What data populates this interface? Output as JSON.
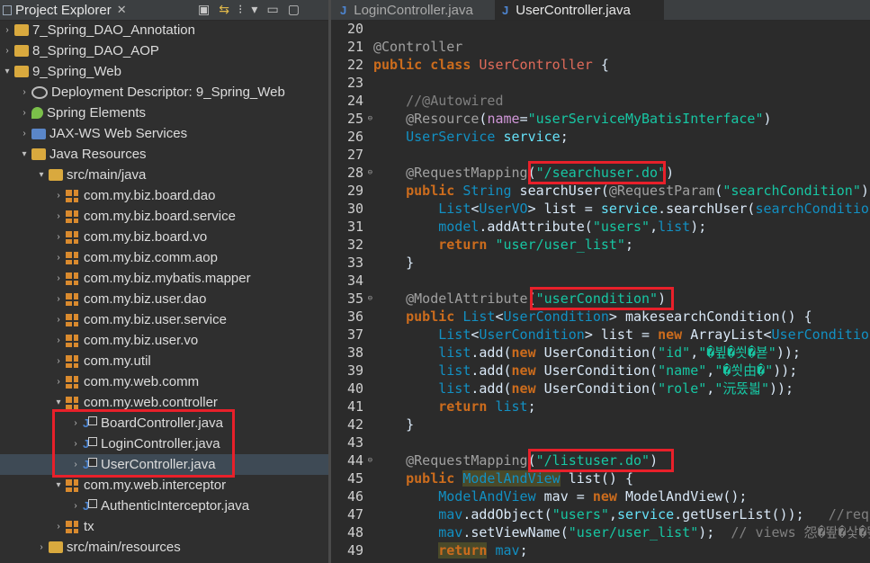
{
  "explorer": {
    "title": "Project Explorer",
    "close": "✕",
    "tools": [
      "▣",
      "⇆",
      "⁝",
      "▾",
      "▭",
      "▢"
    ],
    "rows": [
      {
        "label": "7_Spring_DAO_Annotation",
        "arrow": "›",
        "icon": "project",
        "depth": 0
      },
      {
        "label": "8_Spring_DAO_AOP",
        "arrow": "›",
        "icon": "project",
        "depth": 0
      },
      {
        "label": "9_Spring_Web",
        "arrow": "▾",
        "icon": "project",
        "depth": 0
      },
      {
        "label": "Deployment Descriptor: 9_Spring_Web",
        "arrow": "›",
        "icon": "gear",
        "depth": 1
      },
      {
        "label": "Spring Elements",
        "arrow": "›",
        "icon": "spring",
        "depth": 1
      },
      {
        "label": "JAX-WS Web Services",
        "arrow": "›",
        "icon": "web",
        "depth": 1
      },
      {
        "label": "Java Resources",
        "arrow": "▾",
        "icon": "folder",
        "depth": 1
      },
      {
        "label": "src/main/java",
        "arrow": "▾",
        "icon": "folder",
        "depth": 2
      },
      {
        "label": "com.my.biz.board.dao",
        "arrow": "›",
        "icon": "package",
        "depth": 3
      },
      {
        "label": "com.my.biz.board.service",
        "arrow": "›",
        "icon": "package",
        "depth": 3
      },
      {
        "label": "com.my.biz.board.vo",
        "arrow": "›",
        "icon": "package",
        "depth": 3
      },
      {
        "label": "com.my.biz.comm.aop",
        "arrow": "›",
        "icon": "package",
        "depth": 3
      },
      {
        "label": "com.my.biz.mybatis.mapper",
        "arrow": "›",
        "icon": "package",
        "depth": 3
      },
      {
        "label": "com.my.biz.user.dao",
        "arrow": "›",
        "icon": "package",
        "depth": 3
      },
      {
        "label": "com.my.biz.user.service",
        "arrow": "›",
        "icon": "package",
        "depth": 3
      },
      {
        "label": "com.my.biz.user.vo",
        "arrow": "›",
        "icon": "package",
        "depth": 3
      },
      {
        "label": "com.my.util",
        "arrow": "›",
        "icon": "package",
        "depth": 3
      },
      {
        "label": "com.my.web.comm",
        "arrow": "›",
        "icon": "package",
        "depth": 3
      },
      {
        "label": "com.my.web.controller",
        "arrow": "▾",
        "icon": "package",
        "depth": 3
      },
      {
        "label": "BoardController.java",
        "arrow": "›",
        "icon": "java",
        "depth": 4
      },
      {
        "label": "LoginController.java",
        "arrow": "›",
        "icon": "java",
        "depth": 4
      },
      {
        "label": "UserController.java",
        "arrow": "›",
        "icon": "java",
        "depth": 4,
        "selected": true
      },
      {
        "label": "com.my.web.interceptor",
        "arrow": "▾",
        "icon": "package",
        "depth": 3
      },
      {
        "label": "AuthenticInterceptor.java",
        "arrow": "›",
        "icon": "java",
        "depth": 4
      },
      {
        "label": "tx",
        "arrow": "›",
        "icon": "package",
        "depth": 3
      },
      {
        "label": "src/main/resources",
        "arrow": "›",
        "icon": "folder",
        "depth": 2
      }
    ]
  },
  "editor": {
    "tabs": [
      {
        "label": "LoginController.java",
        "active": false
      },
      {
        "label": "UserController.java",
        "active": true
      }
    ],
    "line_numbers": [
      "20",
      "21",
      "22",
      "23",
      "24",
      "25",
      "26",
      "27",
      "28",
      "29",
      "30",
      "31",
      "32",
      "33",
      "34",
      "35",
      "36",
      "37",
      "38",
      "39",
      "40",
      "41",
      "42",
      "43",
      "44",
      "45",
      "46",
      "47",
      "48",
      "49"
    ],
    "fold_lines": [
      "25",
      "28",
      "35",
      "44"
    ]
  }
}
